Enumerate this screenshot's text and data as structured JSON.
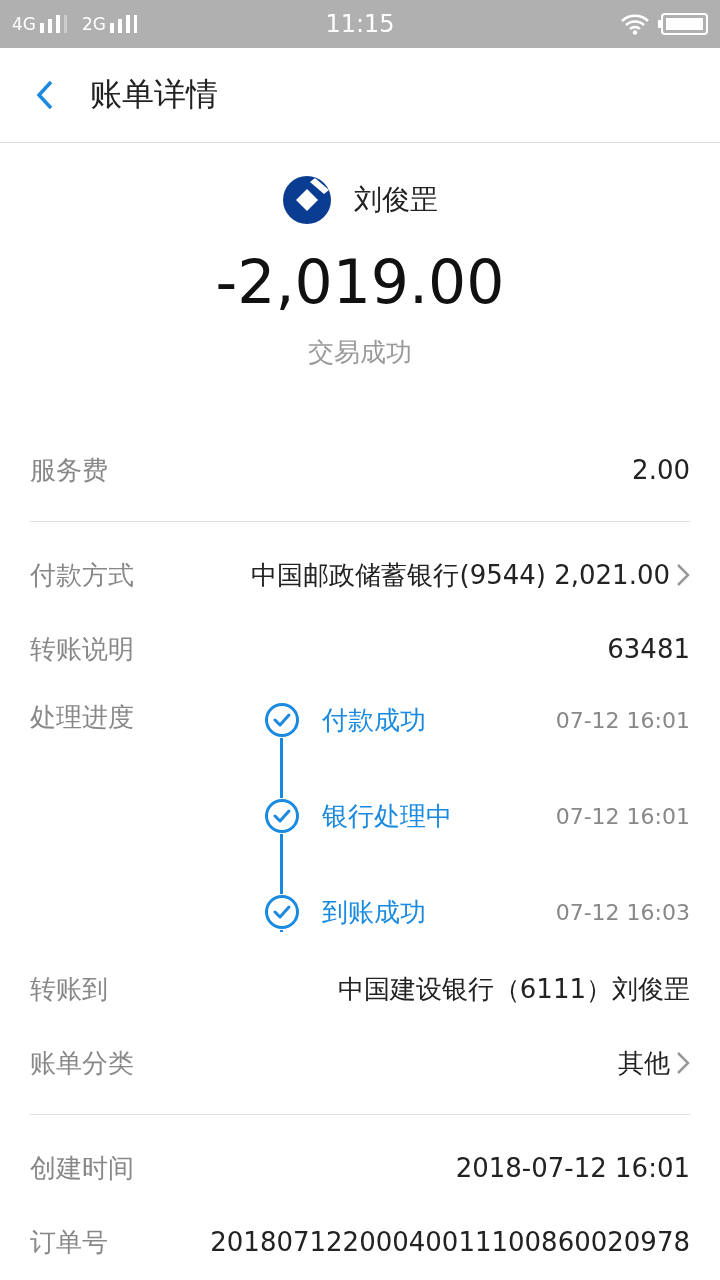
{
  "status_bar": {
    "network_1": "4G",
    "network_2": "2G",
    "time": "11:15"
  },
  "header": {
    "title": "账单详情"
  },
  "summary": {
    "name": "刘俊罡",
    "amount": "-2,019.00",
    "status": "交易成功"
  },
  "sections": [
    [
      {
        "kind": "value",
        "label": "服务费",
        "value": "2.00",
        "link": false
      }
    ],
    [
      {
        "kind": "value",
        "label": "付款方式",
        "value": "中国邮政储蓄银行(9544) 2,021.00",
        "link": true
      },
      {
        "kind": "value",
        "label": "转账说明",
        "value": "63481",
        "link": false
      },
      {
        "kind": "progress",
        "label": "处理进度",
        "steps": [
          {
            "label": "付款成功",
            "time": "07-12 16:01",
            "done": true
          },
          {
            "label": "银行处理中",
            "time": "07-12 16:01",
            "done": true
          },
          {
            "label": "到账成功",
            "time": "07-12 16:03",
            "done": true
          }
        ]
      },
      {
        "kind": "value",
        "label": "转账到",
        "value": "中国建设银行（6111）刘俊罡",
        "link": false
      },
      {
        "kind": "value",
        "label": "账单分类",
        "value": "其他",
        "link": true
      }
    ],
    [
      {
        "kind": "value",
        "label": "创建时间",
        "value": "2018-07-12 16:01",
        "link": false
      },
      {
        "kind": "value",
        "label": "订单号",
        "value": "20180712200040011100860020978",
        "link": false
      }
    ]
  ]
}
